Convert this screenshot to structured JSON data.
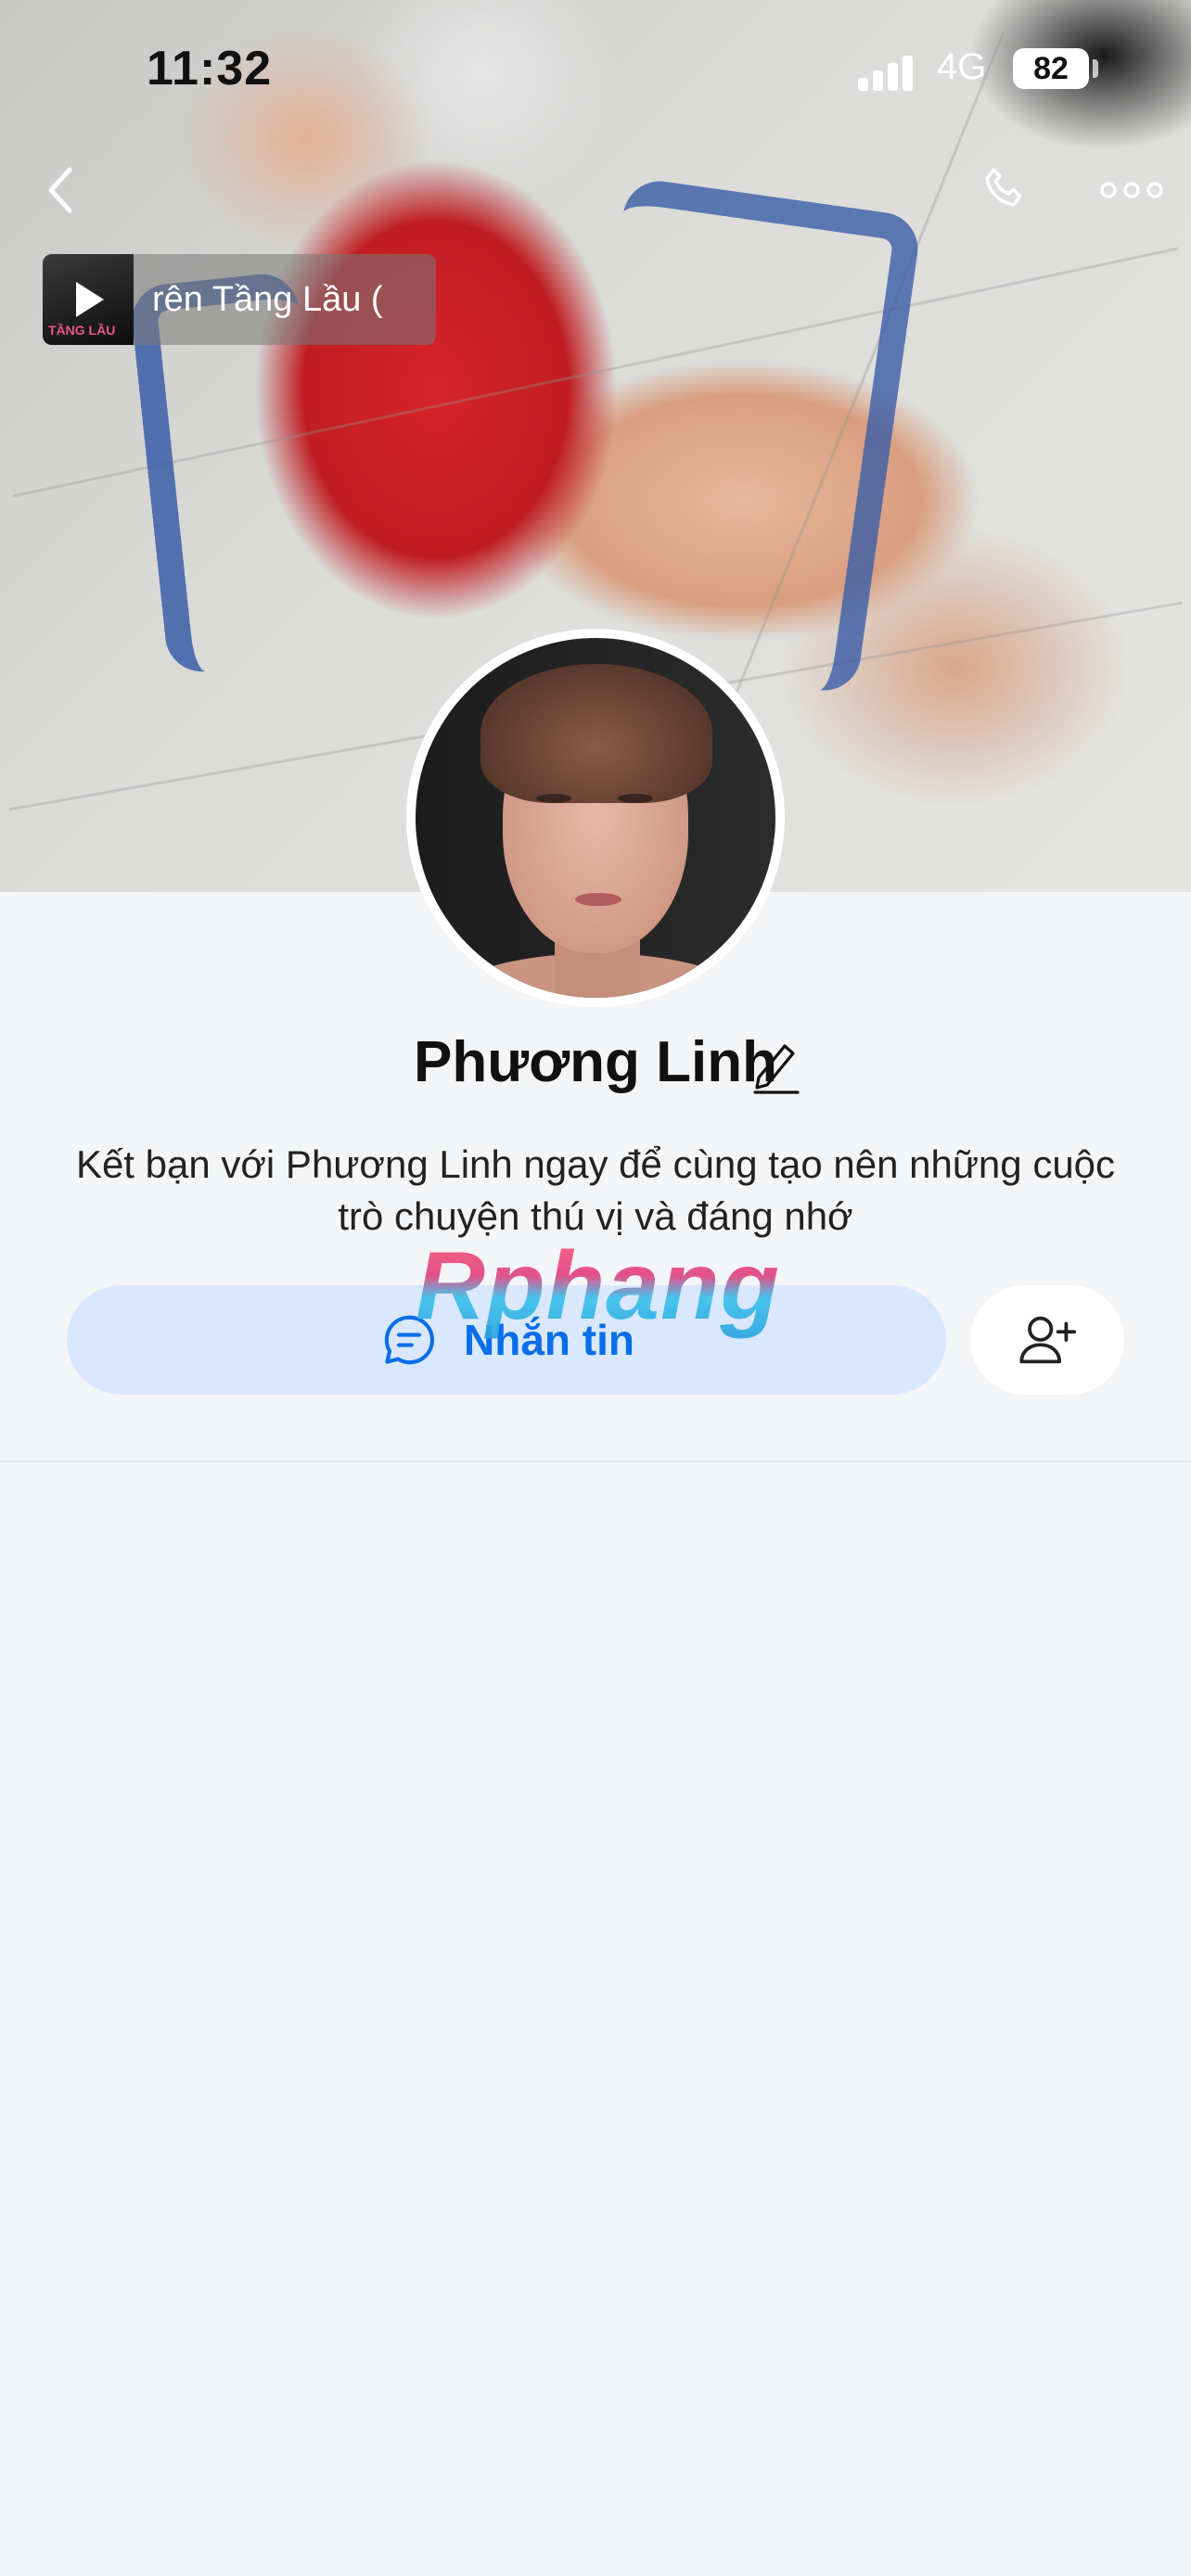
{
  "status_bar": {
    "time": "11:32",
    "network": "4G",
    "battery": "82"
  },
  "header": {
    "back_icon": "chevron-left-icon",
    "call_icon": "phone-icon",
    "more_icon": "more-horizontal-icon"
  },
  "music_banner": {
    "title": "rên Tầng Lầu (",
    "thumb_text": "TẦNG LẦU"
  },
  "profile": {
    "name": "Phương Linh",
    "description": "Kết bạn với Phương Linh ngay để cùng tạo nên những cuộc trò chuyện thú vị và đáng nhớ"
  },
  "actions": {
    "message_label": "Nhắn tin",
    "message_icon": "chat-bubble-icon",
    "add_friend_icon": "add-user-icon"
  },
  "watermark": "Rphang",
  "colors": {
    "accent": "#0a6ee8",
    "message_button_bg": "#d9e8ff",
    "page_bg": "#f4f5f7"
  }
}
